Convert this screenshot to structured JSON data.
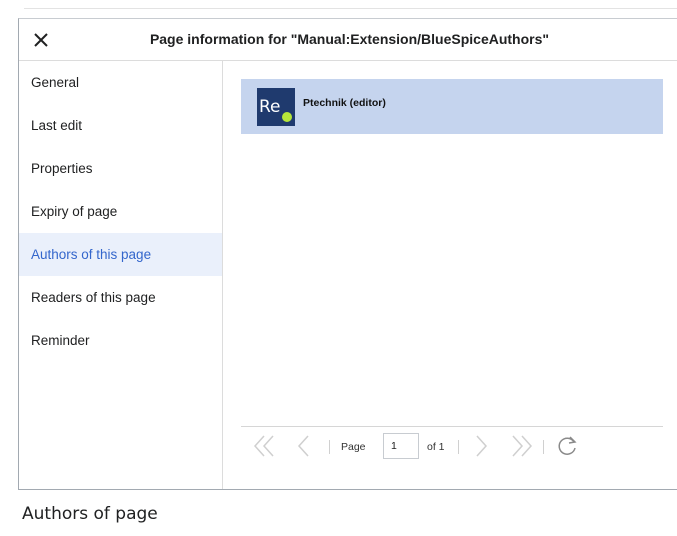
{
  "dialog": {
    "title": "Page information for \"Manual:Extension/BlueSpiceAuthors\"",
    "close_icon": "close-icon"
  },
  "sidebar": {
    "items": [
      {
        "label": "General"
      },
      {
        "label": "Last edit"
      },
      {
        "label": "Properties"
      },
      {
        "label": "Expiry of page"
      },
      {
        "label": "Authors of this page",
        "active": true
      },
      {
        "label": "Readers of this page"
      },
      {
        "label": "Reminder"
      }
    ]
  },
  "authors": [
    {
      "avatar_text": "Re",
      "name": "Ptechnik (editor)"
    }
  ],
  "pager": {
    "page_label": "Page",
    "page_value": "1",
    "of_label": "of 1",
    "icons": [
      "first-page-icon",
      "previous-page-icon",
      "next-page-icon",
      "last-page-icon",
      "refresh-icon"
    ]
  },
  "caption": "Authors of page",
  "colors": {
    "active_nav_bg": "#eaf0fb",
    "active_nav_text": "#3366cc",
    "selected_row_bg": "#c5d4ee",
    "avatar_bg": "#1f3a6e",
    "avatar_dot": "#b6e63a"
  }
}
